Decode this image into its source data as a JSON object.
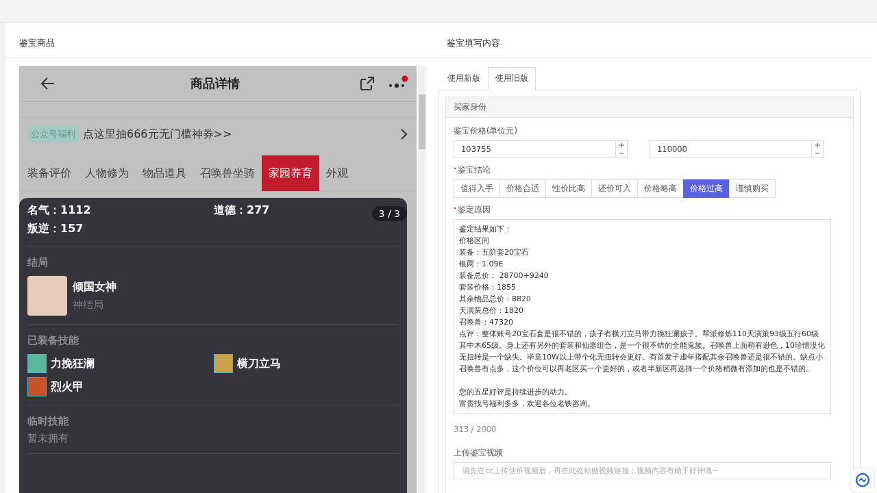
{
  "left_panel": {
    "title": "鉴宝商品",
    "phone": {
      "title": "商品详情",
      "has_notification": true,
      "banner": {
        "tag": "公众号福利",
        "text": "点这里抽666元无门槛神券>>"
      },
      "tabs": [
        {
          "label": "装备评价",
          "selected": false
        },
        {
          "label": "人物修为",
          "selected": false
        },
        {
          "label": "物品道具",
          "selected": false
        },
        {
          "label": "召唤兽坐骑",
          "selected": false
        },
        {
          "label": "家园养育",
          "selected": true
        },
        {
          "label": "外观",
          "selected": false
        }
      ],
      "sheet": {
        "pager": "3 / 3",
        "stats": [
          {
            "label": "名气：",
            "value": "1112"
          },
          {
            "label": "道德：",
            "value": "277"
          },
          {
            "label": "叛逆：",
            "value": "157"
          }
        ],
        "sections": [
          {
            "kind": "ending",
            "title": "结局",
            "name": "倾国女神",
            "sub": "神结局"
          },
          {
            "kind": "skills",
            "title": "已装备技能",
            "skills": [
              "力挽狂澜",
              "横刀立马",
              "烈火甲"
            ]
          },
          {
            "kind": "empty",
            "title": "临时技能",
            "note": "暂未拥有"
          }
        ]
      }
    }
  },
  "right_panel": {
    "title": "鉴宝填写内容",
    "tabs": [
      {
        "label": "使用新版",
        "selected": false
      },
      {
        "label": "使用旧版",
        "selected": true
      }
    ],
    "section_title": "买家身份",
    "price": {
      "label": "鉴宝价格(单位元)",
      "values": [
        "103755",
        "110000"
      ]
    },
    "conclusion": {
      "label": "鉴宝结论",
      "required": true,
      "options": [
        {
          "label": "值得入手",
          "selected": false
        },
        {
          "label": "价格合适",
          "selected": false
        },
        {
          "label": "性价比高",
          "selected": false
        },
        {
          "label": "还价可入",
          "selected": false
        },
        {
          "label": "价格略高",
          "selected": false
        },
        {
          "label": "价格过高",
          "selected": true
        },
        {
          "label": "谨慎购买",
          "selected": false
        }
      ]
    },
    "reason": {
      "label": "鉴定原因",
      "required": true,
      "paragraphs": [
        [
          "鉴定结果如下：",
          "价格区间",
          "装备：五阶套20宝石",
          "银两：1.09E",
          "装备总价： 28700+9240",
          "套装价格：1855",
          "其余物品总价：8820",
          "天演策总价：1820",
          "召唤兽：47320",
          "点评：整体账号20宝石套是很不错的，孩子有横刀立马带力挽狂澜孩子。帮派修炼110天演策93级五行60级其中木65级。身上还有另外的套装和仙器组合，是一个很不错的全能鬼族。召唤兽上面稍有逊色，10珍惜没化无扭转是一个缺失。毕竟10W以上带个化无扭转会更好。有首发子虚年搭配其余召唤兽还是很不错的。缺点小召唤兽有点多，这个价位可以再老区买一个更好的，或者半新区再选择一个价格稍微有添加的也是不错的。"
        ],
        [
          " 您的五星好评是持续进步的动力。",
          "富贵找号福利多多，欢迎各位老铁咨询。"
        ]
      ],
      "count": "313 / 2000"
    },
    "video": {
      "label": "上传鉴宝视频",
      "placeholder": "请先在cc上传估价视频后，再在此处粘贴视频链接；视频内容有助于好评哦~"
    }
  }
}
